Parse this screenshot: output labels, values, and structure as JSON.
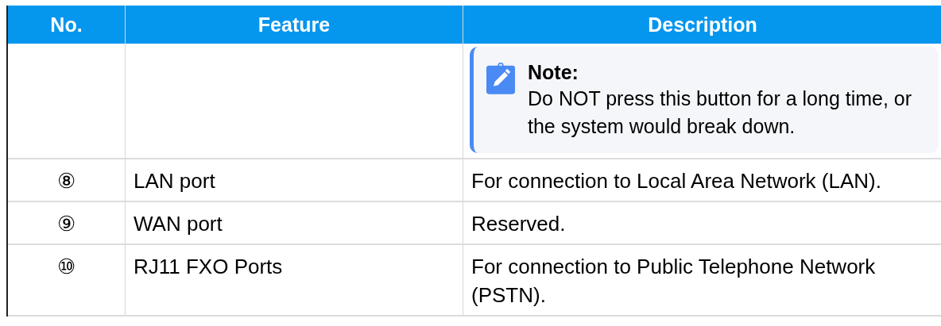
{
  "table": {
    "columns": [
      "No.",
      "Feature",
      "Description"
    ],
    "rows": [
      {
        "note": {
          "title": "Note:",
          "text": "Do NOT press this button for a long time, or the system would break down."
        }
      },
      {
        "number": "⑧",
        "feature": "LAN port",
        "description": "For connection to Local Area Network (LAN)."
      },
      {
        "number": "⑨",
        "feature": "WAN port",
        "description": "Reserved."
      },
      {
        "number": "⑩",
        "feature": "RJ11 FXO Ports",
        "description": "For connection to Public Telephone Network (PSTN)."
      }
    ]
  }
}
